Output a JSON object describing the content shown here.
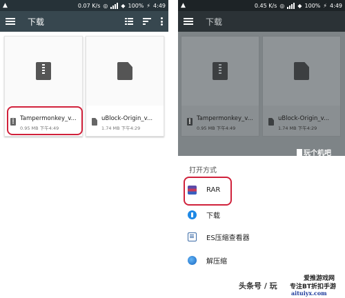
{
  "left": {
    "status": {
      "speed": "0.07 K/s",
      "battery": "100%",
      "time": "4:49"
    },
    "appbar": {
      "title": "下载"
    },
    "files": [
      {
        "name": "Tampermonkey_v...",
        "size": "0.95 MB",
        "time": "下午4:49",
        "icon": "zip-file-icon"
      },
      {
        "name": "uBlock-Origin_v...",
        "size": "1.74 MB",
        "time": "下午4:29",
        "icon": "document-file-icon"
      }
    ]
  },
  "right": {
    "status": {
      "speed": "0.45 K/s",
      "battery": "100%",
      "time": "4:49"
    },
    "appbar": {
      "title": "下载"
    },
    "files": [
      {
        "name": "Tampermonkey_v...",
        "size": "0.95 MB",
        "time": "下午4:49"
      },
      {
        "name": "uBlock-Origin_v...",
        "size": "1.74 MB",
        "time": "下午4:29"
      }
    ],
    "sheet": {
      "title": "打开方式",
      "options": [
        {
          "label": "RAR",
          "icon": "rar-icon"
        },
        {
          "label": "下载",
          "icon": "download-icon"
        },
        {
          "label": "ES压缩查看器",
          "icon": "es-viewer-icon"
        },
        {
          "label": "解压缩",
          "icon": "unzip-icon"
        }
      ]
    }
  },
  "watermarks": {
    "wan": "玩个机吧",
    "toutiao": "头条号 / 玩",
    "aitui_a": "爱推游戏网",
    "aitui_b": "专注BT折扣手游",
    "aitui_c": "aituiyx.com"
  },
  "colors": {
    "highlight": "#d0203a",
    "appbar": "#37474f",
    "statusbar": "#263238"
  }
}
